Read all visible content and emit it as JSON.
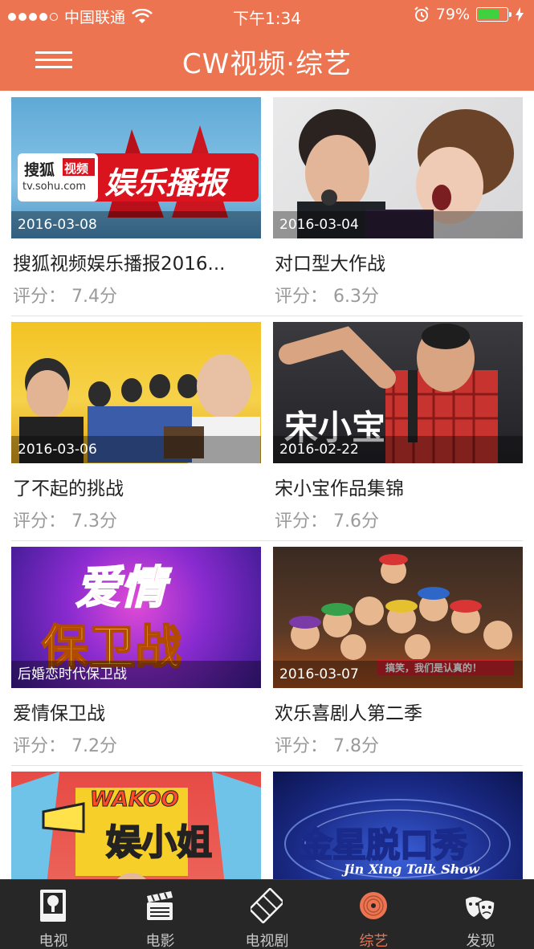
{
  "status_bar": {
    "carrier": "中国联通",
    "time": "下午1:34",
    "battery": "79%",
    "battery_level": 0.79
  },
  "nav": {
    "title": "CW视频·综艺",
    "menu_icon": "hamburger-menu-icon"
  },
  "shows": [
    {
      "title": "搜狐视频娱乐播报2016...",
      "rating": "评分： 7.4分",
      "date": "2016-03-08",
      "art_text": [
        "搜狐",
        "视频",
        "tv.sohu.com",
        "娱乐播报"
      ]
    },
    {
      "title": "对口型大作战",
      "rating": "评分： 6.3分",
      "date": "2016-03-04",
      "art_text": []
    },
    {
      "title": "了不起的挑战",
      "rating": "评分： 7.3分",
      "date": "2016-03-06",
      "art_text": []
    },
    {
      "title": "宋小宝作品集锦",
      "rating": "评分： 7.6分",
      "date": "2016-02-22",
      "art_text": [
        "宋小宝"
      ]
    },
    {
      "title": "爱情保卫战",
      "rating": "评分： 7.2分",
      "date": "后婚恋时代保卫战",
      "art_text": [
        "爱情",
        "保卫战"
      ]
    },
    {
      "title": "欢乐喜剧人第二季",
      "rating": "评分： 7.8分",
      "date": "2016-03-07",
      "art_text": [
        "搞笑，我们是认真的！"
      ]
    },
    {
      "title": "",
      "rating": "",
      "date": "",
      "art_text": [
        "WAKOO",
        "娱小姐"
      ]
    },
    {
      "title": "",
      "rating": "",
      "date": "",
      "art_text": [
        "金星脱口秀",
        "Jin Xing Talk Show"
      ]
    }
  ],
  "tabs": [
    {
      "label": "电视",
      "icon": "tv-icon",
      "active": false
    },
    {
      "label": "电影",
      "icon": "clapperboard-icon",
      "active": false
    },
    {
      "label": "电视剧",
      "icon": "film-strip-icon",
      "active": false
    },
    {
      "label": "综艺",
      "icon": "vinyl-record-icon",
      "active": true
    },
    {
      "label": "发现",
      "icon": "theater-masks-icon",
      "active": false
    }
  ],
  "colors": {
    "brand": "#ec7450",
    "tabbar_bg": "#272727",
    "rating_text": "#9a9a9a",
    "battery_fill": "#3fd13f"
  }
}
